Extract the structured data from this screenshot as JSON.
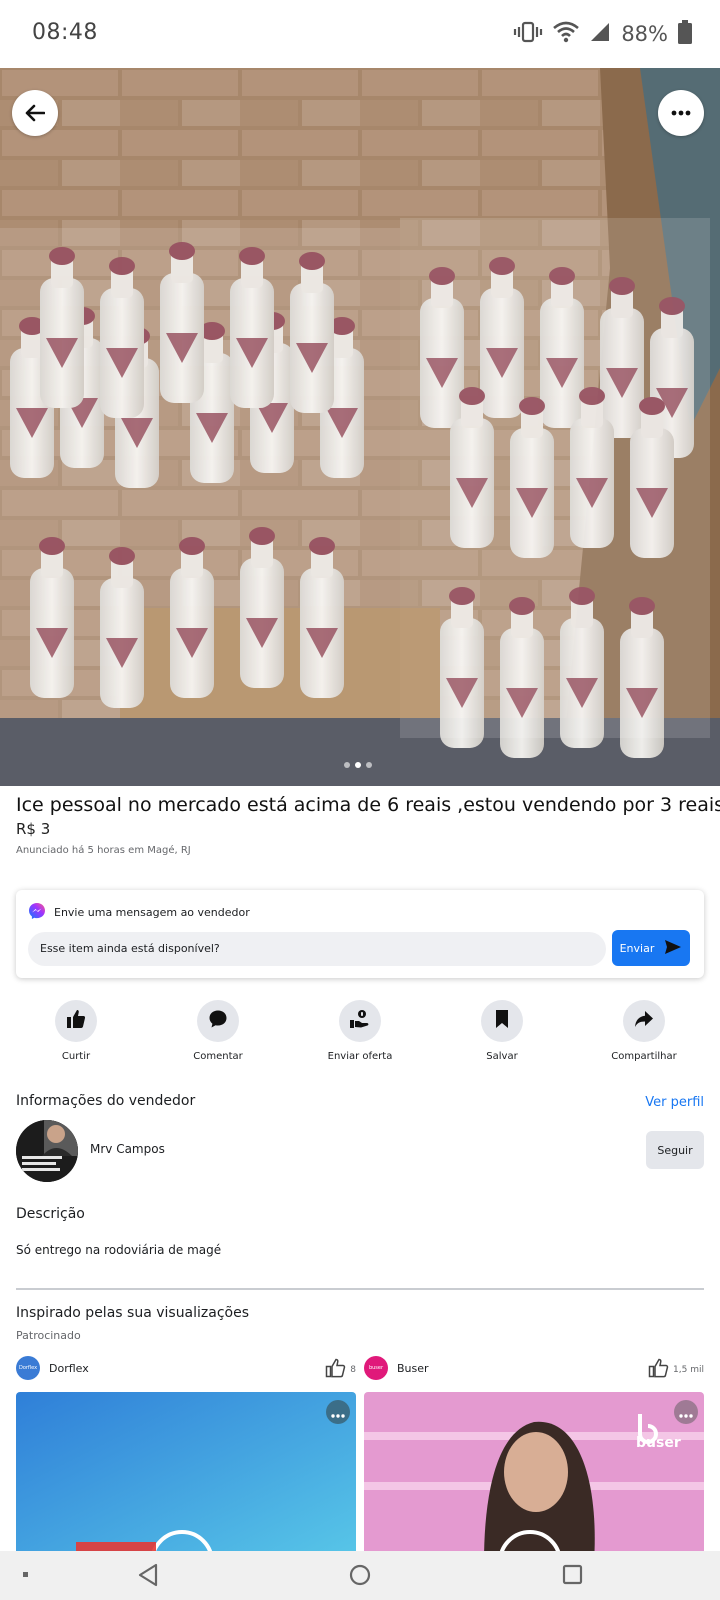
{
  "status_bar": {
    "time": "08:48",
    "battery": "88%"
  },
  "listing": {
    "title": "Ice pessoal no mercado está acima de 6 reais ,estou vendendo por 3 reais",
    "price": "R$ 3",
    "posted": "Anunciado há 5 horas em Magé, RJ",
    "image_count": 3,
    "image_index": 2
  },
  "message": {
    "header": "Envie uma mensagem ao vendedor",
    "input_value": "Esse item ainda está disponível?",
    "send_label": "Enviar"
  },
  "actions": [
    {
      "label": "Curtir",
      "icon": "thumbs-up-icon"
    },
    {
      "label": "Comentar",
      "icon": "comment-icon"
    },
    {
      "label": "Enviar oferta",
      "icon": "offer-icon"
    },
    {
      "label": "Salvar",
      "icon": "bookmark-icon"
    },
    {
      "label": "Compartilhar",
      "icon": "share-icon"
    }
  ],
  "seller": {
    "section_title": "Informações do vendedor",
    "view_profile": "Ver perfil",
    "name": "Mrv Campos",
    "follow_label": "Seguir"
  },
  "description": {
    "title": "Descrição",
    "text": "Só entrego na rodoviária de magé"
  },
  "inspired": {
    "title": "Inspirado pelas sua visualizações",
    "sponsored": "Patrocinado",
    "ads": [
      {
        "name": "Dorflex",
        "likes": "8",
        "logo_text": "Dorflex",
        "logo_color": "#3a7bd5"
      },
      {
        "name": "Buser",
        "likes": "1,5 mil",
        "logo_text": "buser",
        "logo_color": "#e0197a",
        "media_brand": "buser"
      }
    ]
  },
  "colors": {
    "accent": "#1877f2",
    "action_bg": "#e4e6eb",
    "secondary_text": "#65676b"
  }
}
